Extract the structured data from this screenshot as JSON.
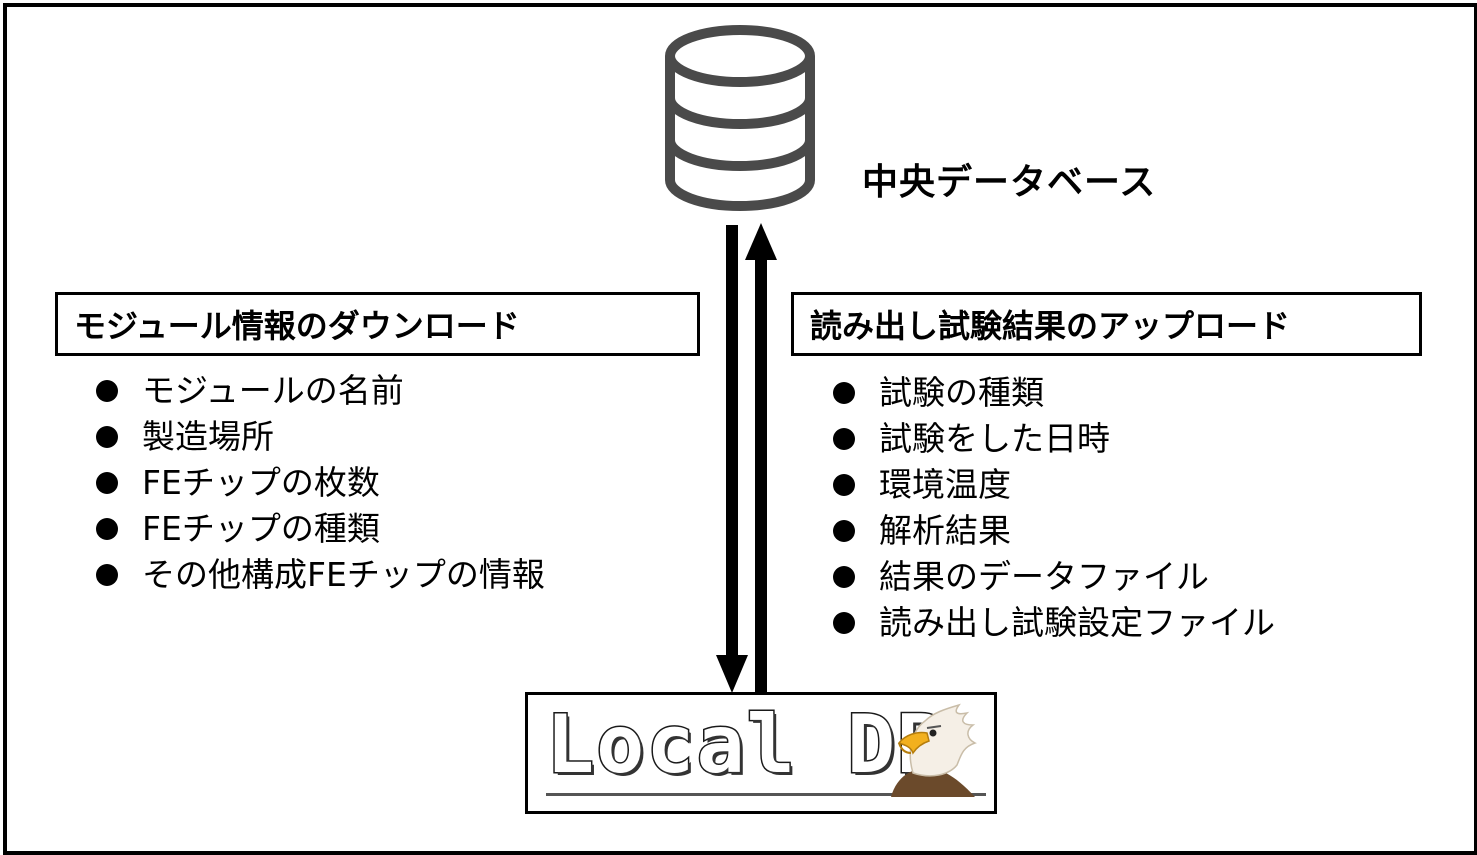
{
  "central_db": {
    "label": "中央データベース",
    "icon": "database-icon"
  },
  "download": {
    "title": "モジュール情報のダウンロード",
    "items": [
      "モジュールの名前",
      "製造場所",
      "FEチップの枚数",
      "FEチップの種類",
      "その他構成FEチップの情報"
    ]
  },
  "upload": {
    "title": "読み出し試験結果のアップロード",
    "items": [
      "試験の種類",
      "試験をした日時",
      "環境温度",
      "解析結果",
      "結果のデータファイル",
      "読み出し試験設定ファイル"
    ]
  },
  "local_db": {
    "logo_text": "Local DB",
    "mascot": "eagle-icon"
  }
}
